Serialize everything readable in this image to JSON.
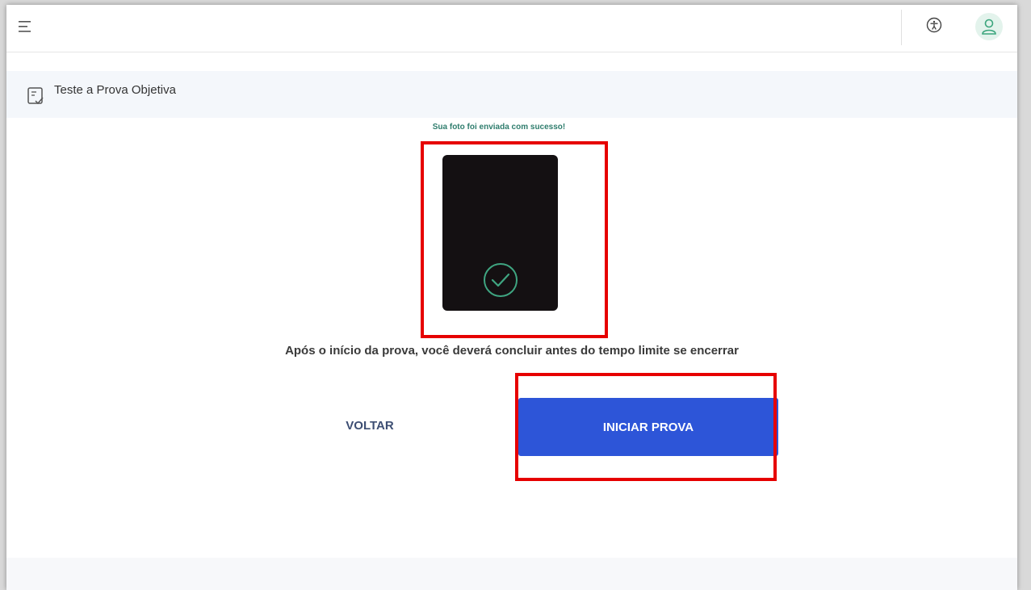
{
  "header": {
    "menu_icon": "hamburger-menu-icon",
    "accessibility_icon": "accessibility-icon",
    "avatar_icon": "user-icon"
  },
  "page": {
    "title": "Teste a Prova Objetiva",
    "title_icon": "exam-checklist-icon"
  },
  "photo": {
    "status_message": "Sua foto foi enviada com sucesso!",
    "status_icon": "check-circle-icon"
  },
  "instruction": "Após o início da prova, você deverá concluir antes do tempo limite se encerrar",
  "actions": {
    "back_label": "VOLTAR",
    "start_label": "INICIAR PROVA"
  },
  "colors": {
    "primary": "#2d55d8",
    "success": "#2f7d6d",
    "highlight": "#e60000",
    "back_text": "#3d4e73"
  }
}
